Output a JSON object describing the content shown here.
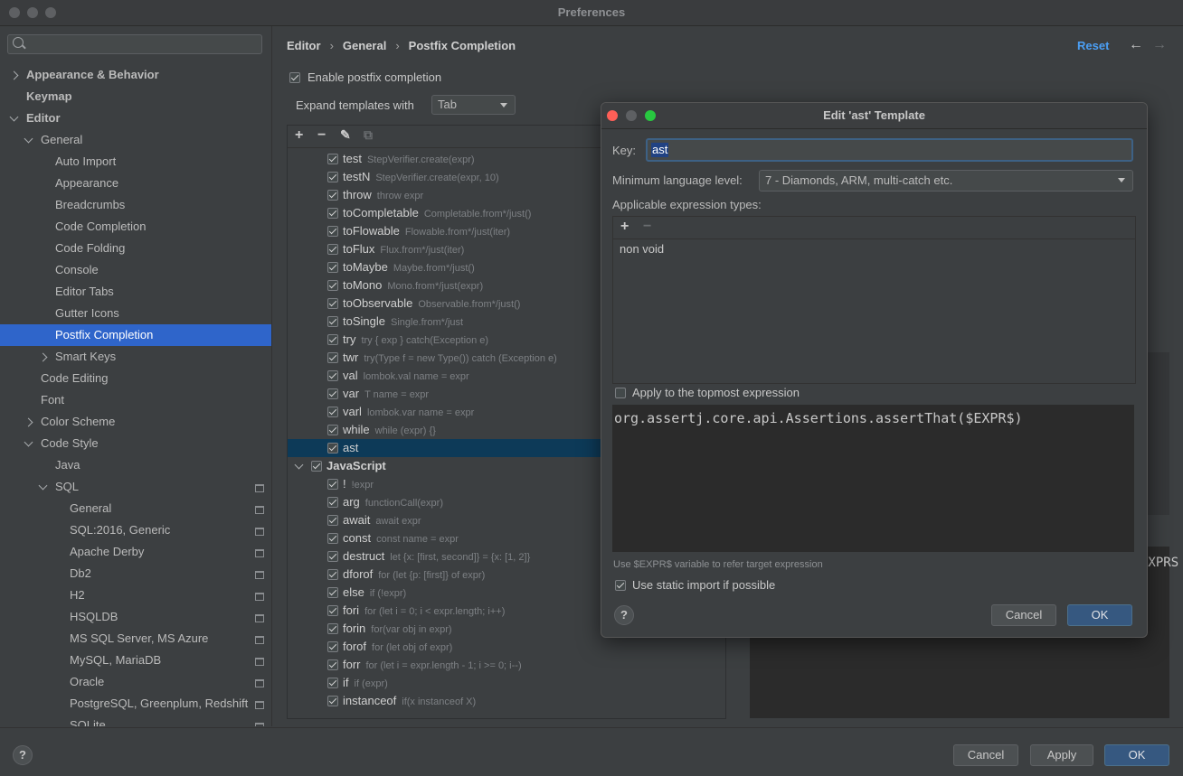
{
  "window": {
    "title": "Preferences"
  },
  "sidebar": {
    "search_placeholder": "",
    "items": [
      {
        "label": "Appearance & Behavior",
        "level": 0,
        "bold": true,
        "chevron": "right"
      },
      {
        "label": "Keymap",
        "level": 0,
        "bold": true,
        "chevron": ""
      },
      {
        "label": "Editor",
        "level": 0,
        "bold": true,
        "chevron": "down"
      },
      {
        "label": "General",
        "level": 1,
        "chevron": "down"
      },
      {
        "label": "Auto Import",
        "level": 2
      },
      {
        "label": "Appearance",
        "level": 2
      },
      {
        "label": "Breadcrumbs",
        "level": 2
      },
      {
        "label": "Code Completion",
        "level": 2
      },
      {
        "label": "Code Folding",
        "level": 2
      },
      {
        "label": "Console",
        "level": 2
      },
      {
        "label": "Editor Tabs",
        "level": 2
      },
      {
        "label": "Gutter Icons",
        "level": 2
      },
      {
        "label": "Postfix Completion",
        "level": 2,
        "selected": true
      },
      {
        "label": "Smart Keys",
        "level": 2,
        "chevron": "right"
      },
      {
        "label": "Code Editing",
        "level": 1
      },
      {
        "label": "Font",
        "level": 1
      },
      {
        "label": "Color Scheme",
        "level": 1,
        "chevron": "right"
      },
      {
        "label": "Code Style",
        "level": 1,
        "chevron": "down"
      },
      {
        "label": "Java",
        "level": 2
      },
      {
        "label": "SQL",
        "level": 2,
        "chevron": "down",
        "proj": true
      },
      {
        "label": "General",
        "level": 3,
        "proj": true
      },
      {
        "label": "SQL:2016, Generic",
        "level": 3,
        "proj": true
      },
      {
        "label": "Apache Derby",
        "level": 3,
        "proj": true
      },
      {
        "label": "Db2",
        "level": 3,
        "proj": true
      },
      {
        "label": "H2",
        "level": 3,
        "proj": true
      },
      {
        "label": "HSQLDB",
        "level": 3,
        "proj": true
      },
      {
        "label": "MS SQL Server, MS Azure",
        "level": 3,
        "proj": true
      },
      {
        "label": "MySQL, MariaDB",
        "level": 3,
        "proj": true
      },
      {
        "label": "Oracle",
        "level": 3,
        "proj": true
      },
      {
        "label": "PostgreSQL, Greenplum, Redshift",
        "level": 3,
        "proj": true
      },
      {
        "label": "SQLite",
        "level": 3,
        "proj": true
      }
    ]
  },
  "breadcrumb": {
    "part1": "Editor",
    "part2": "General",
    "part3": "Postfix Completion",
    "sep": "›"
  },
  "header": {
    "reset_label": "Reset",
    "back_icon": "←",
    "forward_icon": "→"
  },
  "settings": {
    "enable_label": "Enable postfix completion",
    "enable_checked": true,
    "expand_label": "Expand templates with",
    "expand_value": "Tab"
  },
  "templates_toolbar": {
    "add": "+",
    "remove": "−",
    "edit": "✎",
    "copy": "⧉"
  },
  "templates": [
    {
      "key": "test",
      "example": "StepVerifier.create(expr)"
    },
    {
      "key": "testN",
      "example": "StepVerifier.create(expr, 10)"
    },
    {
      "key": "throw",
      "example": "throw expr"
    },
    {
      "key": "toCompletable",
      "example": "Completable.from*/just()"
    },
    {
      "key": "toFlowable",
      "example": "Flowable.from*/just(iter)"
    },
    {
      "key": "toFlux",
      "example": "Flux.from*/just(iter)"
    },
    {
      "key": "toMaybe",
      "example": "Maybe.from*/just()"
    },
    {
      "key": "toMono",
      "example": "Mono.from*/just(expr)"
    },
    {
      "key": "toObservable",
      "example": "Observable.from*/just()"
    },
    {
      "key": "toSingle",
      "example": "Single.from*/just"
    },
    {
      "key": "try",
      "example": "try { exp } catch(Exception e)"
    },
    {
      "key": "twr",
      "example": "try(Type f = new Type()) catch (Exception e)"
    },
    {
      "key": "val",
      "example": "lombok.val name = expr"
    },
    {
      "key": "var",
      "example": "T name = expr"
    },
    {
      "key": "varl",
      "example": "lombok.var name = expr"
    },
    {
      "key": "while",
      "example": "while (expr) {}"
    },
    {
      "key": "ast",
      "example": "",
      "selected": true
    }
  ],
  "js_group": {
    "label": "JavaScript"
  },
  "js_templates": [
    {
      "key": "!",
      "example": "!expr"
    },
    {
      "key": "arg",
      "example": "functionCall(expr)"
    },
    {
      "key": "await",
      "example": "await expr"
    },
    {
      "key": "const",
      "example": "const name = expr"
    },
    {
      "key": "destruct",
      "example": "let {x: [first, second]} = {x: [1, 2]}"
    },
    {
      "key": "dforof",
      "example": "for (let {p: [first]} of expr)"
    },
    {
      "key": "else",
      "example": "if (!expr)"
    },
    {
      "key": "fori",
      "example": "for (let i = 0; i < expr.length; i++)"
    },
    {
      "key": "forin",
      "example": "for(var obj in expr)"
    },
    {
      "key": "forof",
      "example": "for (let obj of expr)"
    },
    {
      "key": "forr",
      "example": "for (let i = expr.length - 1; i >= 0; i--)"
    },
    {
      "key": "if",
      "example": "if (expr)"
    },
    {
      "key": "instanceof",
      "example": "if(x instanceof X)"
    }
  ],
  "right_panel": {
    "partial_text": "EXPRS"
  },
  "dialog": {
    "title": "Edit 'ast' Template",
    "key_label": "Key:",
    "key_value": "ast",
    "min_level_label": "Minimum language level:",
    "min_level_value": "7 - Diamonds, ARM, multi-catch etc.",
    "expr_types_label": "Applicable expression types:",
    "expr_add": "+",
    "expr_remove": "−",
    "expr_types": [
      "non void"
    ],
    "topmost_label": "Apply to the topmost expression",
    "topmost_checked": false,
    "code": "org.assertj.core.api.Assertions.assertThat($EXPR$)",
    "hint": "Use $EXPR$ variable to refer target expression",
    "static_import_label": "Use static import if possible",
    "static_import_checked": true,
    "help": "?",
    "cancel": "Cancel",
    "ok": "OK"
  },
  "footer": {
    "help": "?",
    "cancel": "Cancel",
    "apply": "Apply",
    "ok": "OK"
  },
  "colors": {
    "accent": "#2f65ca",
    "link": "#4b9ff5",
    "bg": "#3c3f41",
    "primary_button": "#365880"
  }
}
